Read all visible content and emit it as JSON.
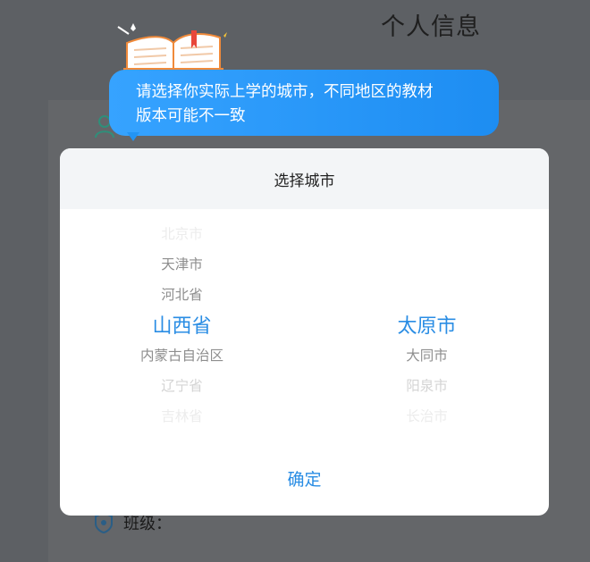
{
  "page": {
    "title": "个人信息",
    "class_label": "班级："
  },
  "tooltip": {
    "text_line1": "请选择你实际上学的城市，不同地区的教材",
    "text_line2": "版本可能不一致"
  },
  "dialog": {
    "title": "选择城市",
    "provinces": [
      "北京市",
      "天津市",
      "河北省",
      "山西省",
      "内蒙古自治区",
      "辽宁省",
      "吉林省"
    ],
    "selected_province": "山西省",
    "cities": [
      "太原市",
      "大同市",
      "阳泉市",
      "长治市"
    ],
    "selected_city": "太原市",
    "confirm_label": "确定"
  },
  "colors": {
    "accent": "#2a8de4",
    "bubble": "#2294f4",
    "overlay": "#5d6064"
  }
}
